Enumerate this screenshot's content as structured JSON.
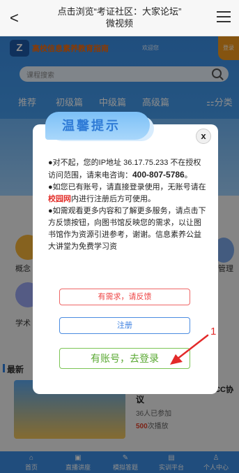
{
  "topbar": {
    "back_glyph": "<",
    "title_line1": "点击浏览“考证社区：大家论坛”",
    "title_line2": "微视频"
  },
  "header": {
    "logo_text": "Z",
    "brand": "高校信息素养教育指南",
    "welcome": "欢迎您",
    "login_flag": "登录"
  },
  "search": {
    "placeholder": "课程搜索"
  },
  "tabs": [
    {
      "label": "推荐"
    },
    {
      "label": "初级篇"
    },
    {
      "label": "中级篇"
    },
    {
      "label": "高级篇"
    }
  ],
  "categories_label": "分类",
  "background_labels": {
    "left_a": "概念",
    "left_b": "学术",
    "right_a": "管理",
    "latest_header": "最新",
    "course_cc": "CC协",
    "course_title": "议",
    "course_participants": "36人已参加",
    "course_plays_num": "500",
    "course_plays_suffix": "次播放"
  },
  "modal": {
    "title": "温馨提示",
    "close_glyph": "x",
    "message": {
      "line1_prefix": "●对不起，您的IP地址 36.17.75.233 不在授权访问范围，请来电咨询：",
      "phone": "400-807-5786",
      "line1_suffix": "。",
      "line2_prefix": "●如您已有账号，请直接登录使用，无账号请在",
      "campus_net": "校园网",
      "line2_suffix": "内进行注册后方可使用。",
      "line3": "●如需观看更多内容和了解更多服务，请点击下方反馈按钮，向图书馆反映您的需求，以让图书馆作为资源引进参考，谢谢。信息素养公益大讲堂为免费学习资"
    },
    "feedback_button": "有需求，请反馈",
    "register_button": "注册",
    "login_button": "有账号，去登录"
  },
  "annotation": {
    "number": "1",
    "color": "#e32a2a"
  },
  "bottom_nav": [
    {
      "label": "首页",
      "icon": "home-icon"
    },
    {
      "label": "直播讲座",
      "icon": "live-icon"
    },
    {
      "label": "模拟答题",
      "icon": "quiz-icon"
    },
    {
      "label": "实训平台",
      "icon": "platform-icon"
    },
    {
      "label": "个人中心",
      "icon": "user-icon"
    }
  ]
}
